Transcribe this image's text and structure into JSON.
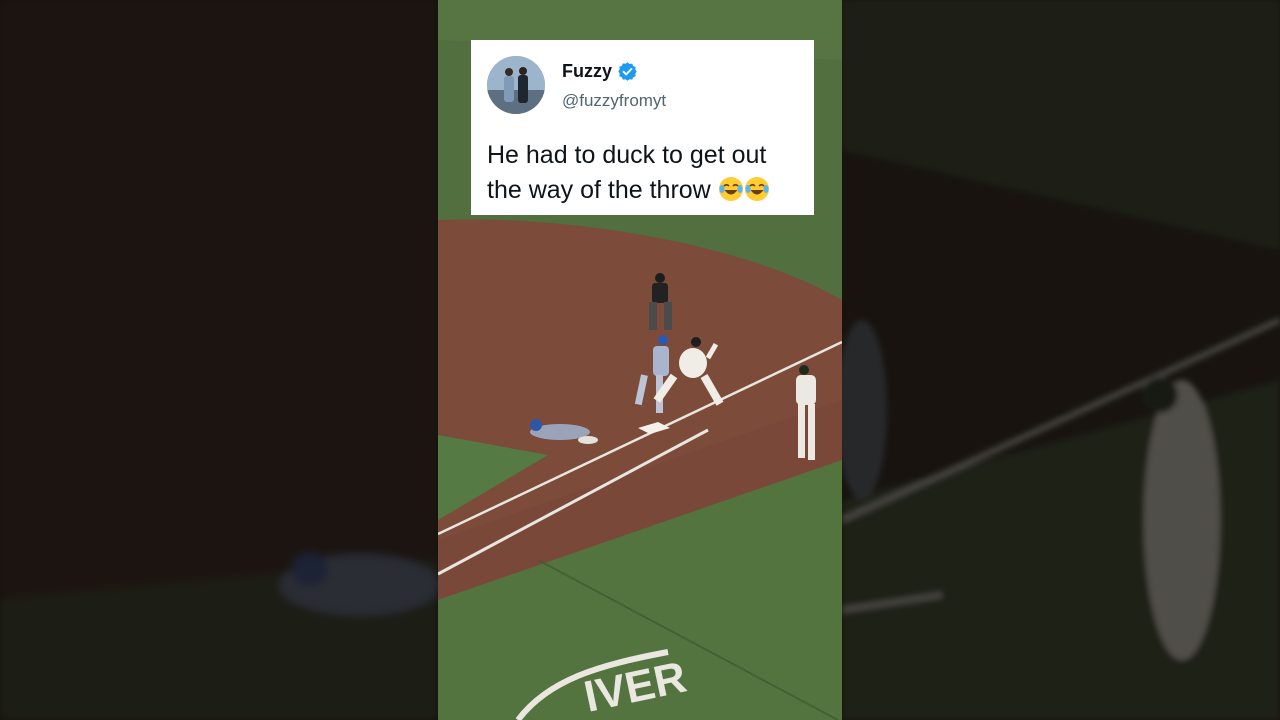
{
  "tweet": {
    "display_name": "Fuzzy",
    "handle": "@fuzzyfromyt",
    "text": "He had to duck to get out the way of the throw",
    "emojis": [
      "face-with-tears-of-joy",
      "face-with-tears-of-joy"
    ],
    "verified": true
  },
  "field_graphics": {
    "ad_text": "IVER"
  },
  "colors": {
    "grass": "#4f6e3d",
    "dirt": "#7a4a3a",
    "verified_badge": "#1d9bf0",
    "card_background": "#ffffff"
  }
}
